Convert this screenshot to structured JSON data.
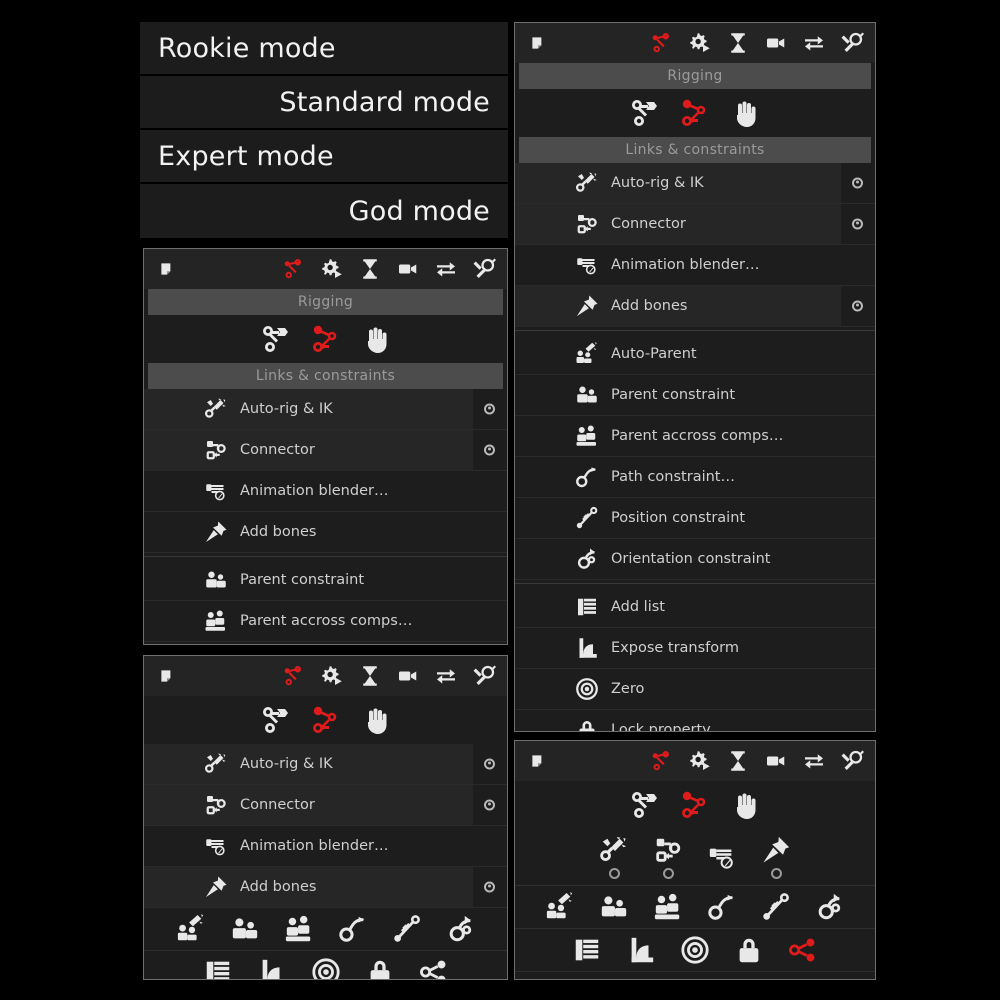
{
  "modes": {
    "items": [
      {
        "label": "Rookie mode",
        "align": "left"
      },
      {
        "label": "Standard mode",
        "align": "right"
      },
      {
        "label": "Expert mode",
        "align": "left"
      },
      {
        "label": "God mode",
        "align": "right"
      }
    ]
  },
  "colors": {
    "accent_red": "#e01b1b",
    "panel_bg": "#1d1d1d",
    "titlebar_bg": "#242424",
    "section_bar": "#4c4c4c",
    "section_text": "#9b9b9b",
    "item_text": "#cfcfcf",
    "panel_border": "#6e6e6e",
    "page_bg": "#000000"
  },
  "titlebar": {
    "doc_icon": "document-icon",
    "tools": [
      {
        "name": "rigging-icon",
        "label": "Rigging",
        "color": "red"
      },
      {
        "name": "automation-gear-icon",
        "label": "Automation",
        "color": "white"
      },
      {
        "name": "hourglass-icon",
        "label": "Timing",
        "color": "white"
      },
      {
        "name": "camera-icon",
        "label": "Camera",
        "color": "white"
      },
      {
        "name": "swap-arrows-icon",
        "label": "Swap",
        "color": "white"
      },
      {
        "name": "tools-icon",
        "label": "Tools",
        "color": "white"
      }
    ]
  },
  "sections": {
    "rigging": "Rigging",
    "links": "Links & constraints"
  },
  "rigging_tools": [
    {
      "name": "armature-icon",
      "label": "Armature",
      "color": "white"
    },
    {
      "name": "connector-node-icon",
      "label": "Connector",
      "color": "red"
    },
    {
      "name": "hand-icon",
      "label": "Hand",
      "color": "white"
    }
  ],
  "items": {
    "auto_rig": {
      "label": "Auto-rig & IK",
      "icon": "autorig-icon",
      "dot": true
    },
    "connector": {
      "label": "Connector",
      "icon": "connector-icon",
      "dot": true
    },
    "anim_blender": {
      "label": "Animation blender…",
      "icon": "anim-blender-icon",
      "dot": false
    },
    "add_bones": {
      "label": "Add bones",
      "icon": "pin-icon",
      "dot": true
    },
    "auto_parent": {
      "label": "Auto-Parent",
      "icon": "auto-parent-icon",
      "dot": false
    },
    "parent_constraint": {
      "label": "Parent constraint",
      "icon": "parent-constraint-icon",
      "dot": false
    },
    "parent_across": {
      "label": "Parent accross comps…",
      "icon": "parent-across-icon",
      "dot": false
    },
    "path_constraint": {
      "label": "Path constraint…",
      "icon": "path-constraint-icon",
      "dot": false
    },
    "position_constraint": {
      "label": "Position constraint",
      "icon": "position-constraint-icon",
      "dot": false
    },
    "orientation_constraint": {
      "label": "Orientation constraint",
      "icon": "orientation-constraint-icon",
      "dot": false
    },
    "add_list": {
      "label": "Add list",
      "icon": "list-icon",
      "dot": false
    },
    "expose_transform": {
      "label": "Expose transform",
      "icon": "expose-transform-icon",
      "dot": false
    },
    "zero": {
      "label": "Zero",
      "icon": "target-icon",
      "dot": false
    },
    "lock_property": {
      "label": "Lock property",
      "icon": "lock-icon",
      "dot": false
    },
    "separate_dimensions": {
      "label": "Separate Dimensions",
      "icon": "separate-dimensions-icon",
      "dot": false
    }
  },
  "panels": {
    "expert": {
      "mode": "Expert mode",
      "has_sections": true,
      "item_keys": [
        "auto_rig",
        "connector",
        "anim_blender",
        "add_bones",
        "auto_parent",
        "parent_constraint",
        "parent_across",
        "path_constraint",
        "position_constraint",
        "orientation_constraint",
        "add_list",
        "expose_transform",
        "zero",
        "lock_property",
        "separate_dimensions"
      ]
    },
    "standard": {
      "mode": "Standard mode",
      "has_sections": true,
      "item_keys": [
        "auto_rig",
        "connector",
        "anim_blender",
        "add_bones",
        "parent_constraint",
        "parent_across"
      ]
    },
    "rookie": {
      "mode": "Rookie mode",
      "has_sections": false,
      "item_keys": [
        "auto_rig",
        "connector",
        "anim_blender",
        "add_bones"
      ],
      "icon_rows": [
        [
          "auto_parent",
          "parent_constraint",
          "parent_across",
          "path_constraint",
          "position_constraint",
          "orientation_constraint"
        ],
        [
          "add_list",
          "expose_transform",
          "zero",
          "lock_property",
          "separate_dimensions"
        ]
      ]
    },
    "god": {
      "mode": "God mode",
      "has_sections": false,
      "icon_rows": [
        [
          "auto_rig",
          "connector",
          "anim_blender",
          "add_bones"
        ],
        [
          "auto_parent",
          "parent_constraint",
          "parent_across",
          "path_constraint",
          "position_constraint",
          "orientation_constraint"
        ],
        [
          "add_list",
          "expose_transform",
          "zero",
          "lock_property",
          "separate_dimensions"
        ]
      ]
    }
  }
}
